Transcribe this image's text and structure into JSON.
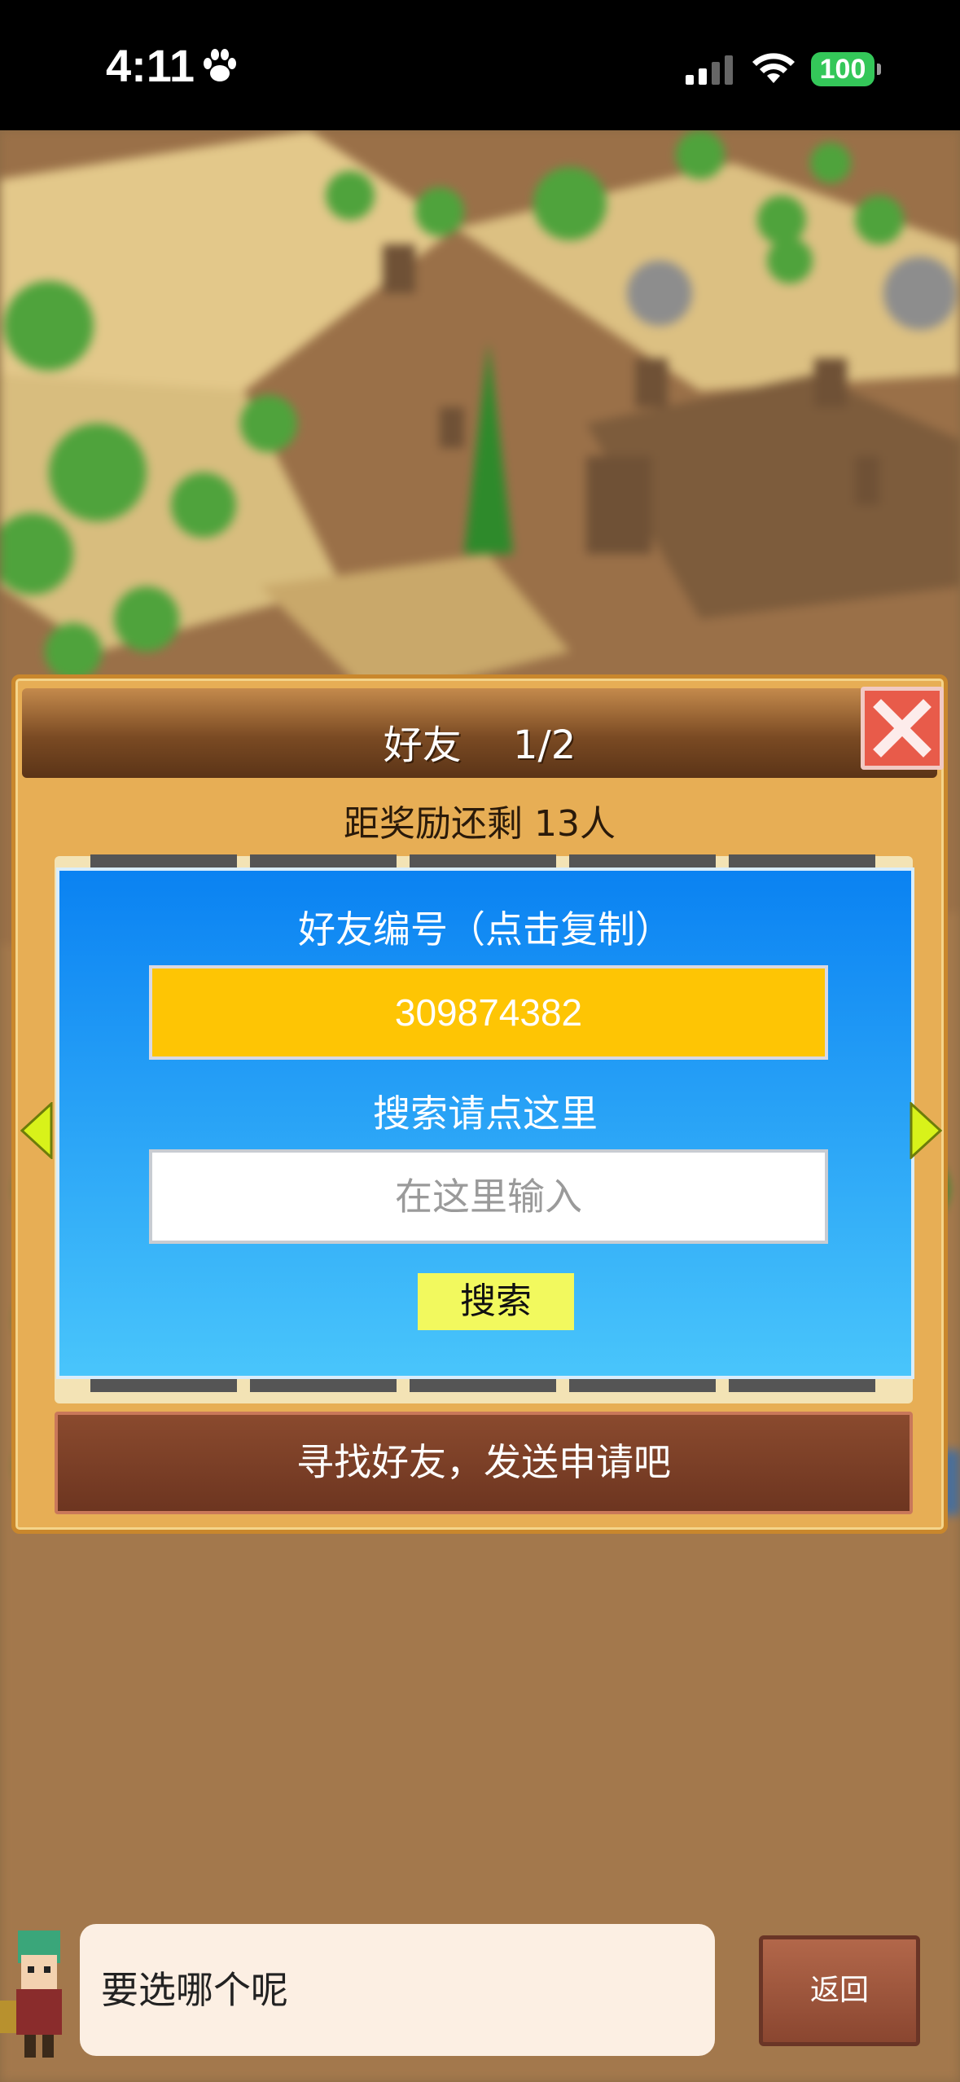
{
  "status_bar": {
    "time": "4:11",
    "battery": "100",
    "icons": [
      "paw-icon",
      "signal-icon",
      "wifi-icon",
      "battery-icon"
    ]
  },
  "dialog": {
    "title": "好友　 1/2",
    "reward_text": "距奖励还剩 13人",
    "friend_id_label": "好友编号（点击复制）",
    "friend_id": "309874382",
    "search_label": "搜索请点这里",
    "search_placeholder": "在这里输入",
    "search_button": "搜索",
    "find_friends_button": "寻找好友，发送申请吧"
  },
  "bottom": {
    "speech_text": "要选哪个呢",
    "back_button": "返回"
  },
  "colors": {
    "panel_blue_top": "#0a82f2",
    "panel_blue_bottom": "#49c5fb",
    "id_box": "#fec504",
    "search_button": "#f2f95e",
    "close_button": "#e85b4a",
    "battery": "#34c759"
  }
}
